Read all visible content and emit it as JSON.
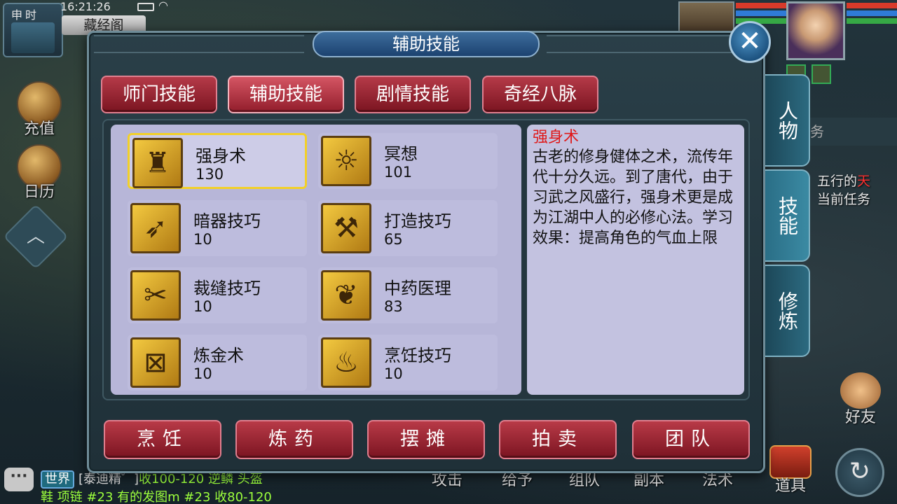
{
  "hud": {
    "shichen": "申时",
    "time": "16:21:26",
    "map_name": "藏经阁",
    "side_buttons": [
      {
        "label": "充值",
        "icon": "treasure-chest-icon"
      },
      {
        "label": "日历",
        "icon": "calendar-drum-icon"
      }
    ],
    "side_arrow_icon": "chevron-up-icon",
    "task_peek": "务",
    "task_line1_prefix": "五行的",
    "task_line1_highlight": "天",
    "task_line2": "当前任务",
    "friend_label": "好友",
    "bottom_actions": [
      "攻击",
      "给予",
      "组队",
      "副本",
      "法术"
    ],
    "item_label": "道具",
    "refresh_icon": "refresh-icon"
  },
  "chat": {
    "channel": "世界",
    "sender": "[泰迪精゜]",
    "line1_msg": "收100-120 逆鳞 头盔",
    "line2": "鞋 项链 #23 有的发图m #23 收80-120"
  },
  "dialog": {
    "title": "辅助技能",
    "close_icon": "close-icon",
    "tabs": [
      {
        "label": "师门技能",
        "active": false
      },
      {
        "label": "辅助技能",
        "active": true
      },
      {
        "label": "剧情技能",
        "active": false
      },
      {
        "label": "奇经八脉",
        "active": false
      }
    ],
    "skills": [
      {
        "name": "强身术",
        "level": "130",
        "icon": "strength-icon",
        "selected": true
      },
      {
        "name": "冥想",
        "level": "101",
        "icon": "meditation-icon",
        "selected": false
      },
      {
        "name": "暗器技巧",
        "level": "10",
        "icon": "dart-icon",
        "selected": false
      },
      {
        "name": "打造技巧",
        "level": "65",
        "icon": "hammer-icon",
        "selected": false
      },
      {
        "name": "裁缝技巧",
        "level": "10",
        "icon": "scissors-icon",
        "selected": false
      },
      {
        "name": "中药医理",
        "level": "83",
        "icon": "herb-icon",
        "selected": false
      },
      {
        "name": "炼金术",
        "level": "10",
        "icon": "alchemy-icon",
        "selected": false
      },
      {
        "name": "烹饪技巧",
        "level": "10",
        "icon": "cooking-icon",
        "selected": false
      }
    ],
    "description": {
      "title": "强身术",
      "body": "古老的修身健体之术，流传年代十分久远。到了唐代，由于习武之风盛行，强身术更是成为江湖中人的必修心法。学习效果：提高角色的气血上限"
    },
    "bottom_buttons": [
      "烹饪",
      "炼药",
      "摆摊",
      "拍卖",
      "团队"
    ],
    "side_tabs": [
      {
        "label": "人物",
        "active": false
      },
      {
        "label": "技能",
        "active": true
      },
      {
        "label": "修炼",
        "active": false
      }
    ]
  },
  "colors": {
    "tab_red": "#921d2b",
    "selected_border": "#f2d028",
    "desc_title": "#e01818",
    "chat_green": "#9cff3c"
  }
}
